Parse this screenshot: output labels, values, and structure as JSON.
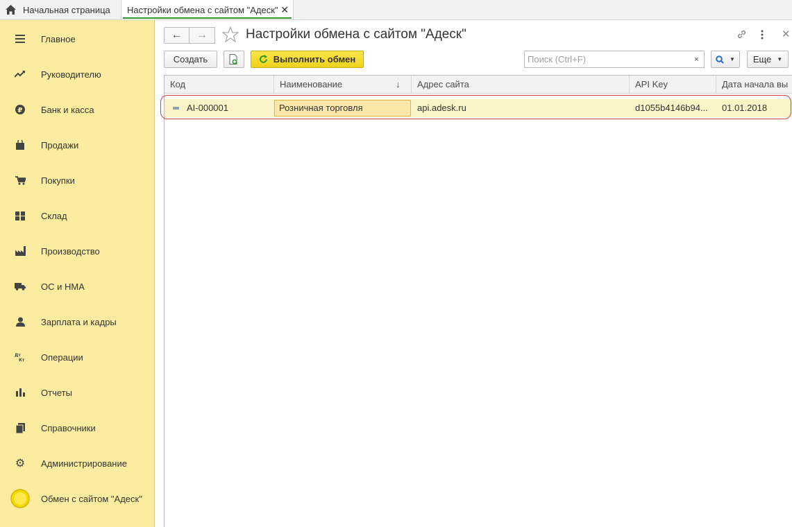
{
  "tabs": {
    "home_label": "Начальная страница",
    "active_label": "Настройки обмена с сайтом \"Адеск\""
  },
  "sidebar": {
    "items": [
      {
        "label": "Главное",
        "icon": "menu-lines-icon"
      },
      {
        "label": "Руководителю",
        "icon": "trend-up-icon"
      },
      {
        "label": "Банк и касса",
        "icon": "ruble-coin-icon"
      },
      {
        "label": "Продажи",
        "icon": "shopping-bag-icon"
      },
      {
        "label": "Покупки",
        "icon": "cart-icon"
      },
      {
        "label": "Склад",
        "icon": "warehouse-grid-icon"
      },
      {
        "label": "Производство",
        "icon": "factory-icon"
      },
      {
        "label": "ОС и НМА",
        "icon": "truck-icon"
      },
      {
        "label": "Зарплата и кадры",
        "icon": "person-icon"
      },
      {
        "label": "Операции",
        "icon": "debit-credit-icon"
      },
      {
        "label": "Отчеты",
        "icon": "bar-chart-icon"
      },
      {
        "label": "Справочники",
        "icon": "books-icon"
      },
      {
        "label": "Администрирование",
        "icon": "gear-icon"
      },
      {
        "label": "Обмен с сайтом \"Адеск\"",
        "icon": "yellow-circle-icon"
      }
    ]
  },
  "form": {
    "title": "Настройки обмена с сайтом \"Адеск\""
  },
  "toolbar": {
    "create_label": "Создать",
    "exchange_label": "Выполнить обмен",
    "search_placeholder": "Поиск (Ctrl+F)",
    "clear_label": "×",
    "more_label": "Еще"
  },
  "table": {
    "columns": [
      "Код",
      "Наименование",
      "Адрес сайта",
      "API Key",
      "Дата начала вы"
    ],
    "sort_indicator": "↓",
    "rows": [
      {
        "code": "AI-000001",
        "name": "Розничная торговля",
        "site": "api.adesk.ru",
        "api_key": "d1055b4146b94...",
        "start_date": "01.01.2018"
      }
    ]
  },
  "colors": {
    "sidebar_bg": "#fbeca0",
    "accent_green": "#2e9a2e",
    "exchange_button": "#f0d21a",
    "row_highlight": "#fbf3c8",
    "annotation_red": "#d4404a"
  }
}
